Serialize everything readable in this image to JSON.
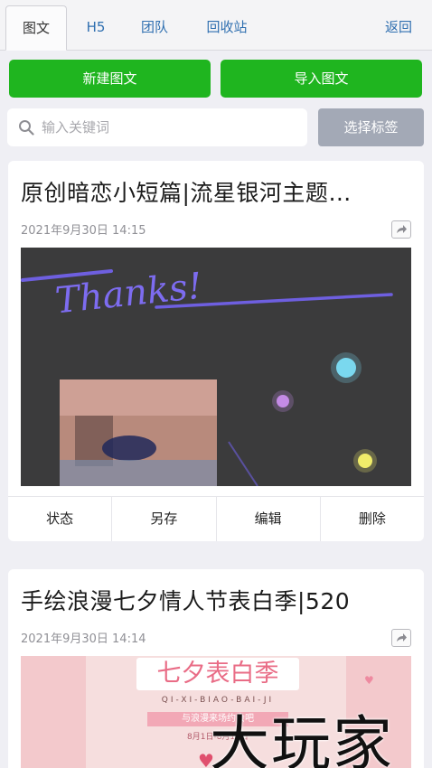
{
  "tabs": [
    {
      "label": "图文",
      "active": true
    },
    {
      "label": "H5",
      "active": false
    },
    {
      "label": "团队",
      "active": false
    },
    {
      "label": "回收站",
      "active": false
    }
  ],
  "back_label": "返回",
  "actions": {
    "new_label": "新建图文",
    "import_label": "导入图文"
  },
  "search": {
    "placeholder": "输入关键词",
    "value": "",
    "icon": "search-icon"
  },
  "tag_button_label": "选择标签",
  "articles": [
    {
      "title": "原创暗恋小短篇|流星银河主题…",
      "date": "2021年9月30日 14:15",
      "cover_text": "Thanks!",
      "buttons": [
        "状态",
        "另存",
        "编辑",
        "删除"
      ]
    },
    {
      "title": "手绘浪漫七夕情人节表白季|520",
      "date": "2021年9月30日 14:14",
      "cover_title": "七夕表白季",
      "cover_pinyin": "QI-XI-BIAO-BAI-JI",
      "cover_line": "与浪漫来场约会吧",
      "cover_date": "8月1日-8月14日"
    }
  ],
  "watermark": "大玩家",
  "colors": {
    "accent_green": "#1fb51f",
    "tab_link": "#2f6fb0",
    "tag_button": "#a3a9b6",
    "background": "#efeff4"
  }
}
